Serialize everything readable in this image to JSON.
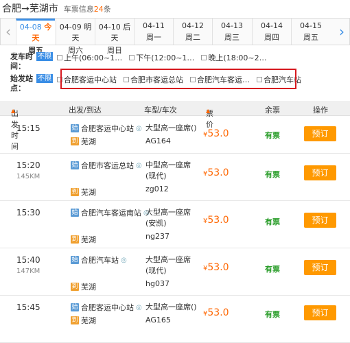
{
  "header": {
    "route": "合肥→芜湖市",
    "info_prefix": "车票信息",
    "count": "24",
    "info_suffix": "条"
  },
  "date_tabs": [
    {
      "date": "04-08",
      "tag": "今天",
      "weekday": "周五",
      "active": true
    },
    {
      "date": "04-09",
      "tag": "明天",
      "weekday": "周六",
      "active": false
    },
    {
      "date": "04-10",
      "tag": "后天",
      "weekday": "周日",
      "active": false
    },
    {
      "date": "04-11",
      "tag": "",
      "weekday": "周一",
      "active": false
    },
    {
      "date": "04-12",
      "tag": "",
      "weekday": "周二",
      "active": false
    },
    {
      "date": "04-13",
      "tag": "",
      "weekday": "周三",
      "active": false
    },
    {
      "date": "04-14",
      "tag": "",
      "weekday": "周四",
      "active": false
    },
    {
      "date": "04-15",
      "tag": "",
      "weekday": "周五",
      "active": false
    }
  ],
  "filters": {
    "time": {
      "label": "发车时间：",
      "badge": "不限",
      "options": [
        "上午(06:00~1…",
        "下午(12:00~1…",
        "晚上(18:00~2…"
      ]
    },
    "station": {
      "label": "始发站点：",
      "badge": "不限",
      "options": [
        "合肥客运中心站",
        "合肥市客运总站",
        "合肥汽车客运…",
        "合肥汽车站"
      ]
    }
  },
  "columns": {
    "depart_time": "出发时间",
    "route": "出发/到达",
    "type": "车型/车次",
    "price": "票价",
    "remain": "余票",
    "action": "操作"
  },
  "trips": [
    {
      "time": "15:15",
      "km": "",
      "from": "合肥客运中心站",
      "to": "芜湖",
      "seat": "大型高一座席()",
      "no": "AG164",
      "price": "53.0",
      "remain": "有票",
      "action": "预订"
    },
    {
      "time": "15:20",
      "km": "145KM",
      "from": "合肥市客运总站",
      "to": "芜湖",
      "seat": "中型高一座席(现代)",
      "no": "zg012",
      "price": "53.0",
      "remain": "有票",
      "action": "预订"
    },
    {
      "time": "15:30",
      "km": "",
      "from": "合肥汽车客运南站",
      "to": "芜湖",
      "seat": "大型高一座席(安凯)",
      "no": "ng237",
      "price": "53.0",
      "remain": "有票",
      "action": "预订"
    },
    {
      "time": "15:40",
      "km": "147KM",
      "from": "合肥汽车站",
      "to": "芜湖",
      "seat": "大型高一座席(现代)",
      "no": "hg037",
      "price": "53.0",
      "remain": "有票",
      "action": "预订"
    },
    {
      "time": "15:45",
      "km": "",
      "from": "合肥客运中心站",
      "to": "芜湖",
      "seat": "大型高一座席()",
      "no": "AG165",
      "price": "53.0",
      "remain": "有票",
      "action": "预订"
    }
  ],
  "icons": {
    "from_icon": "始",
    "to_icon": "到",
    "currency": "¥",
    "left_arrow": "‹",
    "right_arrow": "›"
  },
  "colors": {
    "accent": "#3a8ee6",
    "price": "#ff6600",
    "button": "#ff9900",
    "available": "#2a9d2a",
    "highlight_box": "#d6191f"
  }
}
